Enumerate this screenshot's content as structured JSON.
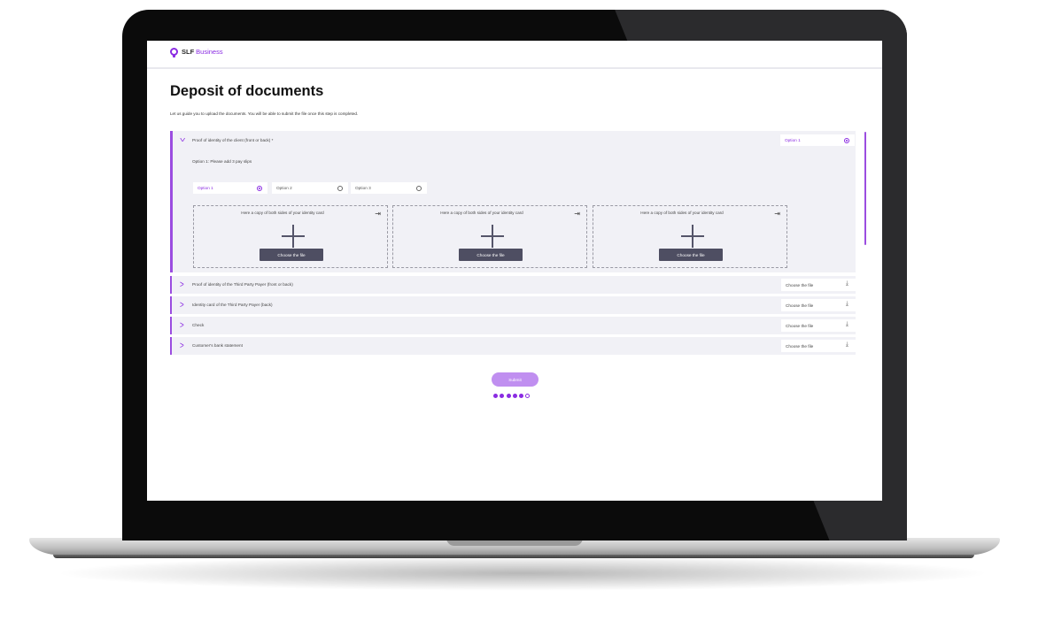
{
  "brand": {
    "slf": "SLF",
    "business": "Business"
  },
  "page": {
    "title": "Deposit of documents",
    "intro": "Let us guide you to upload the documents. You will be able to submit the file once this step is completed."
  },
  "expanded_section": {
    "title": "Proof of identity of the client (front or back) *",
    "selected_option": "Option 1",
    "instruction": "Option 1: Please add 3 pay slips",
    "options": [
      {
        "label": "Option 1",
        "selected": true
      },
      {
        "label": "Option 2",
        "selected": false
      },
      {
        "label": "Option 3",
        "selected": false
      }
    ],
    "dropzones": [
      {
        "text": "Here a copy of both sides of your identity card",
        "button": "Choose the file"
      },
      {
        "text": "Here a copy of both sides of your identity card",
        "button": "Choose the file"
      },
      {
        "text": "Here a copy of both sides of your identity card",
        "button": "Choose the file"
      }
    ]
  },
  "collapsed_sections": [
    {
      "title": "Proof of identity of the Third Party Payer (front or back)",
      "file_label": "Choose the file"
    },
    {
      "title": "Identity card of the Third Party Payer (back)",
      "file_label": "Choose the file"
    },
    {
      "title": "Check",
      "file_label": "Choose the file"
    },
    {
      "title": "Customer's bank statement",
      "file_label": "Choose the file"
    }
  ],
  "submit_label": "Submit",
  "progress": {
    "completed_steps": 5,
    "total_steps": 6
  },
  "colors": {
    "accent": "#8a2be2",
    "button_dark": "#4e4e62",
    "panel_bg": "#f1f1f6"
  }
}
